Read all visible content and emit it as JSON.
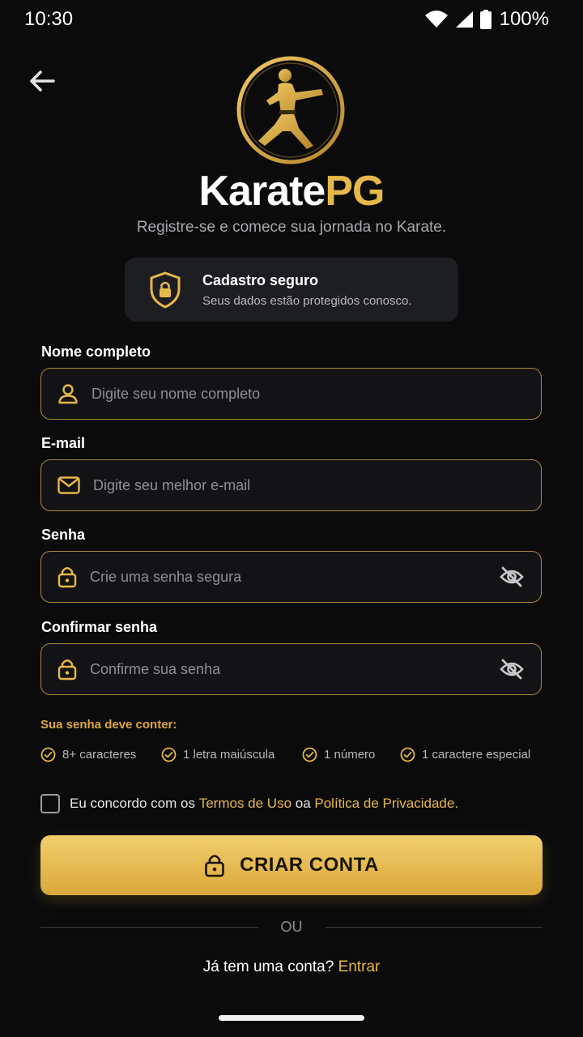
{
  "status_bar": {
    "time": "10:30",
    "battery": "100%"
  },
  "brand": {
    "part1": "Karate",
    "part2": "PG"
  },
  "subtitle": "Registre-se e comece sua jornada no Karate.",
  "secure_card": {
    "title": "Cadastro seguro",
    "description": "Seus dados estão protegidos conosco."
  },
  "fields": {
    "name": {
      "label": "Nome completo",
      "placeholder": "Digite seu nome completo",
      "value": ""
    },
    "email": {
      "label": "E-mail",
      "placeholder": "Digite seu melhor e-mail",
      "value": ""
    },
    "password": {
      "label": "Senha",
      "placeholder": "Crie uma senha segura",
      "value": ""
    },
    "confirm": {
      "label": "Confirmar senha",
      "placeholder": "Confirme sua senha",
      "value": ""
    }
  },
  "requirements": {
    "title": "Sua senha deve conter:",
    "items": [
      "8+ caracteres",
      "1 letra maiúscula",
      "1 número",
      "1 caractere especial"
    ]
  },
  "terms": {
    "prefix": "Eu concordo com os ",
    "terms_link": "Termos de Uso",
    "middle": " oa ",
    "privacy_link": "Política de Privacidade",
    "suffix": "."
  },
  "cta": {
    "label": "CRIAR CONTA"
  },
  "divider": {
    "label": "OU"
  },
  "login": {
    "prompt": "Já tem uma conta? ",
    "link": "Entrar"
  },
  "colors": {
    "accent": "#e6b84a",
    "background": "#0b0b0c",
    "field_border": "#a88a3a"
  },
  "icons": {
    "back": "arrow-left-icon",
    "logo": "karate-logo-icon",
    "secure": "shield-lock-icon",
    "name": "user-icon",
    "email": "mail-icon",
    "password": "lock-icon",
    "eye": "eye-off-icon",
    "check": "check-circle-icon",
    "cta": "lock-icon"
  }
}
